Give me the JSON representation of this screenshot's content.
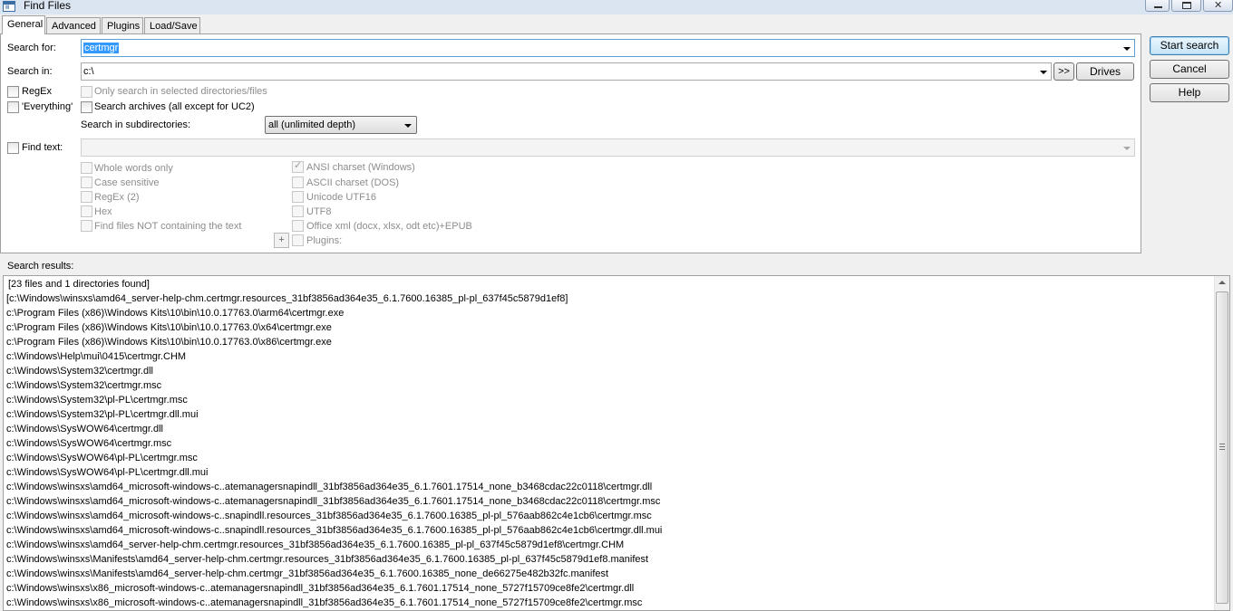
{
  "window": {
    "title": "Find Files",
    "icon": "app-icon",
    "icon_text": "Ⅲ"
  },
  "tabs": [
    {
      "label": "General",
      "active": true
    },
    {
      "label": "Advanced",
      "active": false
    },
    {
      "label": "Plugins",
      "active": false
    },
    {
      "label": "Load/Save",
      "active": false
    }
  ],
  "general": {
    "search_for_label": "Search for:",
    "search_for_value": "certmgr",
    "search_in_label": "Search in:",
    "search_in_value": "c:\\",
    "browse_button": ">>",
    "drives_button": "Drives",
    "regex_label": "RegEx",
    "everything_label": "'Everything'",
    "only_selected_label": "Only search in selected directories/files",
    "search_archives_label": "Search archives (all except for UC2)",
    "subdirs_label": "Search in subdirectories:",
    "subdirs_value": "all (unlimited depth)",
    "find_text_label": "Find text:",
    "find_text_value": "",
    "options_left": [
      "Whole words only",
      "Case sensitive",
      "RegEx (2)",
      "Hex",
      "Find files NOT containing the text"
    ],
    "options_right": [
      {
        "label": "ANSI charset (Windows)",
        "checked": true
      },
      {
        "label": "ASCII charset (DOS)",
        "checked": false
      },
      {
        "label": "Unicode UTF16",
        "checked": false
      },
      {
        "label": "UTF8",
        "checked": false
      },
      {
        "label": "Office xml (docx, xlsx, odt etc)+EPUB",
        "checked": false
      }
    ],
    "plus_button": "+",
    "plugins_label": "Plugins:"
  },
  "actions": {
    "start_search": "Start search",
    "cancel": "Cancel",
    "help": "Help"
  },
  "results": {
    "label": "Search results:",
    "lines": [
      "[23 files and 1 directories found]",
      "[c:\\Windows\\winsxs\\amd64_server-help-chm.certmgr.resources_31bf3856ad364e35_6.1.7600.16385_pl-pl_637f45c5879d1ef8]",
      "c:\\Program Files (x86)\\Windows Kits\\10\\bin\\10.0.17763.0\\arm64\\certmgr.exe",
      "c:\\Program Files (x86)\\Windows Kits\\10\\bin\\10.0.17763.0\\x64\\certmgr.exe",
      "c:\\Program Files (x86)\\Windows Kits\\10\\bin\\10.0.17763.0\\x86\\certmgr.exe",
      "c:\\Windows\\Help\\mui\\0415\\certmgr.CHM",
      "c:\\Windows\\System32\\certmgr.dll",
      "c:\\Windows\\System32\\certmgr.msc",
      "c:\\Windows\\System32\\pl-PL\\certmgr.msc",
      "c:\\Windows\\System32\\pl-PL\\certmgr.dll.mui",
      "c:\\Windows\\SysWOW64\\certmgr.dll",
      "c:\\Windows\\SysWOW64\\certmgr.msc",
      "c:\\Windows\\SysWOW64\\pl-PL\\certmgr.msc",
      "c:\\Windows\\SysWOW64\\pl-PL\\certmgr.dll.mui",
      "c:\\Windows\\winsxs\\amd64_microsoft-windows-c..atemanagersnapindll_31bf3856ad364e35_6.1.7601.17514_none_b3468cdac22c0118\\certmgr.dll",
      "c:\\Windows\\winsxs\\amd64_microsoft-windows-c..atemanagersnapindll_31bf3856ad364e35_6.1.7601.17514_none_b3468cdac22c0118\\certmgr.msc",
      "c:\\Windows\\winsxs\\amd64_microsoft-windows-c..snapindll.resources_31bf3856ad364e35_6.1.7600.16385_pl-pl_576aab862c4e1cb6\\certmgr.msc",
      "c:\\Windows\\winsxs\\amd64_microsoft-windows-c..snapindll.resources_31bf3856ad364e35_6.1.7600.16385_pl-pl_576aab862c4e1cb6\\certmgr.dll.mui",
      "c:\\Windows\\winsxs\\amd64_server-help-chm.certmgr.resources_31bf3856ad364e35_6.1.7600.16385_pl-pl_637f45c5879d1ef8\\certmgr.CHM",
      "c:\\Windows\\winsxs\\Manifests\\amd64_server-help-chm.certmgr.resources_31bf3856ad364e35_6.1.7600.16385_pl-pl_637f45c5879d1ef8.manifest",
      "c:\\Windows\\winsxs\\Manifests\\amd64_server-help-chm.certmgr_31bf3856ad364e35_6.1.7600.16385_none_de66275e482b32fc.manifest",
      "c:\\Windows\\winsxs\\x86_microsoft-windows-c..atemanagersnapindll_31bf3856ad364e35_6.1.7601.17514_none_5727f15709ce8fe2\\certmgr.dll",
      "c:\\Windows\\winsxs\\x86_microsoft-windows-c..atemanagersnapindll_31bf3856ad364e35_6.1.7601.17514_none_5727f15709ce8fe2\\certmgr.msc"
    ]
  }
}
